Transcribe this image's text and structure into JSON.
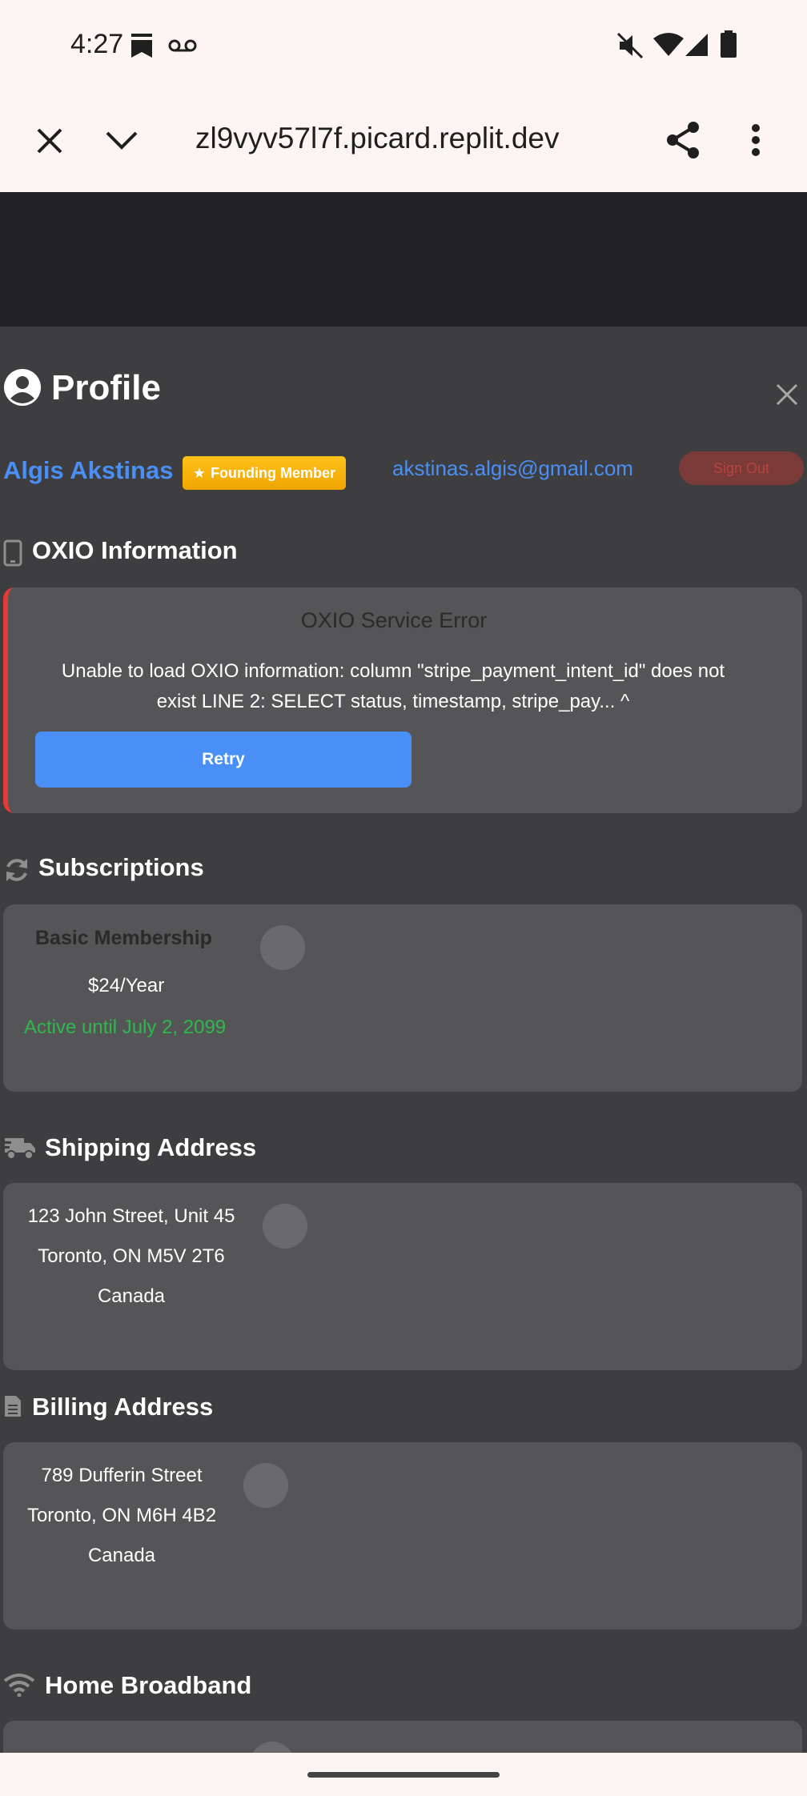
{
  "status_bar": {
    "time": "4:27"
  },
  "browser": {
    "url": "zl9vyv57l7f.picard.replit.dev"
  },
  "profile": {
    "title": "Profile",
    "name": "Algis Akstinas",
    "badge": "Founding Member",
    "email": "akstinas.algis@gmail.com",
    "red_pill": "Sign Out"
  },
  "oxio": {
    "section_title": "OXIO Information",
    "error_title": "OXIO Service Error",
    "error_line1": "Unable to load OXIO information: column \"stripe_payment_intent_id\" does not",
    "error_line2": "exist LINE 2: SELECT status, timestamp, stripe_pay... ^",
    "retry_label": "Retry"
  },
  "subscriptions": {
    "section_title": "Subscriptions",
    "plan_name": "Basic Membership",
    "price": "$24/Year",
    "status": "Active until July 2, 2099"
  },
  "shipping": {
    "section_title": "Shipping Address",
    "line1": "123 John Street, Unit 45",
    "line2": "Toronto, ON M5V 2T6",
    "line3": "Canada"
  },
  "billing": {
    "section_title": "Billing Address",
    "line1": "789 Dufferin Street",
    "line2": "Toronto, ON M6H 4B2",
    "line3": "Canada"
  },
  "broadband": {
    "section_title": "Home Broadband"
  },
  "colors": {
    "accent_blue": "#4a8ff5",
    "error_red": "#e53935",
    "success_green": "#2fb84e",
    "badge_gold": "#f5b400",
    "overlay_bg": "#3e3e40",
    "card_bg": "#555557"
  }
}
